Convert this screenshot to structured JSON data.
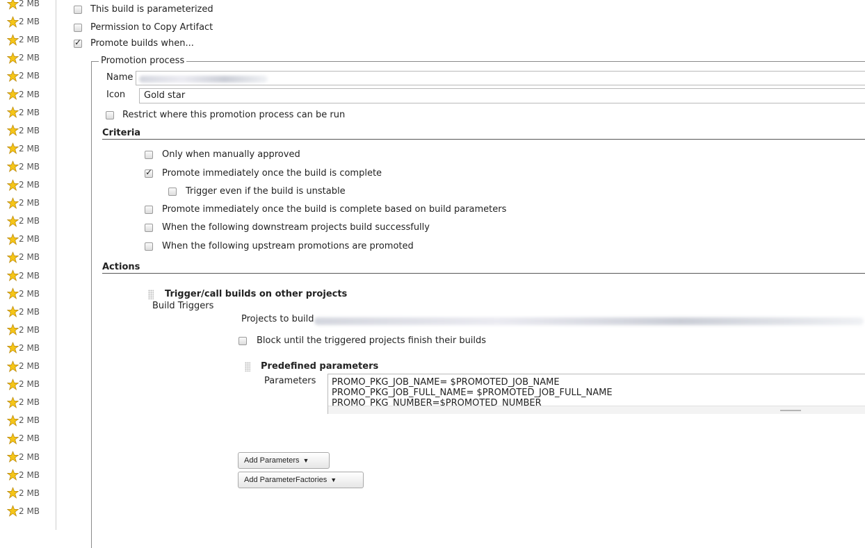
{
  "sidebar": {
    "size_label": "2 MB",
    "row_count": 29,
    "icon": "gold-star-icon"
  },
  "options": {
    "parameterized": {
      "label": "This build is parameterized",
      "checked": false
    },
    "copy_artifact": {
      "label": "Permission to Copy Artifact",
      "checked": false
    },
    "promote_builds": {
      "label": "Promote builds when...",
      "checked": true
    }
  },
  "promotion": {
    "legend": "Promotion process",
    "name_label": "Name",
    "name_value": "",
    "icon_label": "Icon",
    "icon_value": "Gold star",
    "restrict_label": "Restrict where this promotion process can be run"
  },
  "criteria": {
    "title": "Criteria",
    "items": [
      {
        "label": "Only when manually approved",
        "checked": false
      },
      {
        "label": "Promote immediately once the build is complete",
        "checked": true
      },
      {
        "label": "Trigger even if the build is unstable",
        "checked": false
      },
      {
        "label": "Promote immediately once the build is complete based on build parameters",
        "checked": false
      },
      {
        "label": "When the following downstream projects build successfully",
        "checked": false
      },
      {
        "label": "When the following upstream promotions are promoted",
        "checked": false
      }
    ]
  },
  "actions": {
    "title": "Actions",
    "trigger_title": "Trigger/call builds on other projects",
    "build_triggers_label": "Build Triggers",
    "projects_label": "Projects to build",
    "block_label": "Block until the triggered projects finish their builds",
    "predefined_title": "Predefined parameters",
    "parameters_label": "Parameters",
    "parameters_lines": [
      "PROMO_PKG_JOB_NAME= $PROMOTED_JOB_NAME",
      "PROMO_PKG_JOB_FULL_NAME= $PROMOTED_JOB_FULL_NAME",
      "PROMO_PKG_NUMBER=$PROMOTED_NUMBER"
    ],
    "add_parameters_button": "Add Parameters",
    "add_parameter_factories_button": "Add ParameterFactories"
  }
}
